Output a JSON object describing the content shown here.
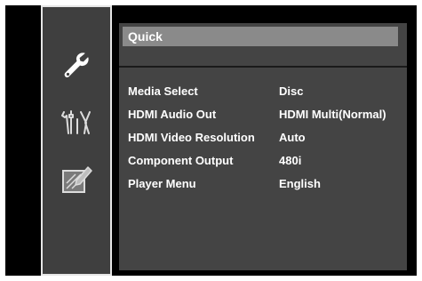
{
  "sidebar": {
    "icons": [
      {
        "name": "wrench-icon"
      },
      {
        "name": "tools-icon"
      },
      {
        "name": "edit-icon"
      }
    ]
  },
  "menu": {
    "title": "Quick",
    "items": [
      {
        "label": "Media Select",
        "value": "Disc"
      },
      {
        "label": "HDMI Audio Out",
        "value": "HDMI Multi(Normal)"
      },
      {
        "label": "HDMI Video Resolution",
        "value": "Auto"
      },
      {
        "label": "Component Output",
        "value": "480i"
      },
      {
        "label": "Player Menu",
        "value": "English"
      }
    ]
  },
  "colors": {
    "background": "#000000",
    "panel": "#444444",
    "title_bar": "#8a8a8a",
    "sidebar": "#3f3f3f",
    "text": "#ffffff"
  }
}
